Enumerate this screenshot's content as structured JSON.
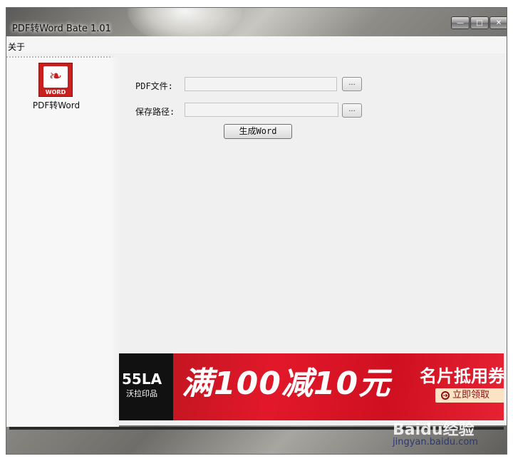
{
  "window": {
    "title": "PDF转Word Bate 1.01",
    "caption_buttons": [
      "minimize-icon",
      "maximize-icon",
      "close-icon"
    ]
  },
  "menu": {
    "items": [
      "关于"
    ]
  },
  "sidebar": {
    "tool": {
      "icon_badge": "PDF转WORD",
      "label": "PDF转Word"
    }
  },
  "form": {
    "pdf_file_label": "PDF文件:",
    "pdf_file_value": "",
    "save_path_label": "保存路径:",
    "save_path_value": "",
    "browse_label": "...",
    "generate_label": "生成Word"
  },
  "ad": {
    "logo_big": "55LA",
    "logo_small": "沃拉印品",
    "headline": "满100减10元",
    "sub": "名片抵用券",
    "cta": "立即领取"
  },
  "watermark": {
    "logo": "Baidu经验",
    "url": "jingyan.baidu.com"
  },
  "colors": {
    "ad_red": "#e2182a",
    "icon_red": "#c8201e"
  }
}
